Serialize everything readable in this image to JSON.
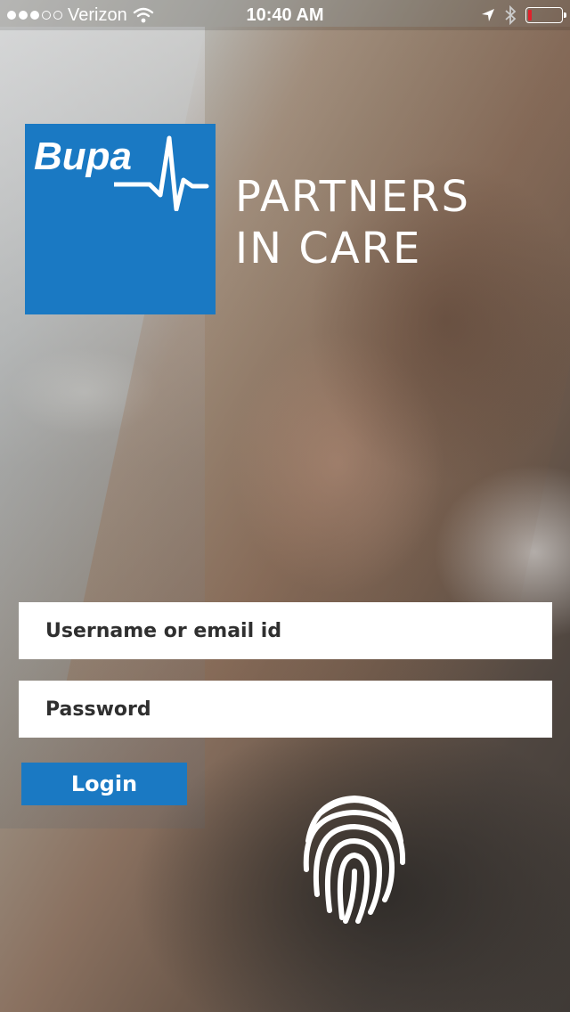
{
  "status_bar": {
    "carrier": "Verizon",
    "time": "10:40 AM",
    "signal_bars_filled": 3,
    "signal_bars_total": 5,
    "battery_level": 0.1
  },
  "brand": {
    "logo_text": "Bupa",
    "tagline_line1": "PARTNERS",
    "tagline_line2": "IN CARE",
    "accent_color": "#1a79c3"
  },
  "login_form": {
    "username_placeholder": "Username or email id",
    "password_placeholder": "Password",
    "login_label": "Login"
  },
  "icons": {
    "fingerprint": "fingerprint-icon"
  }
}
